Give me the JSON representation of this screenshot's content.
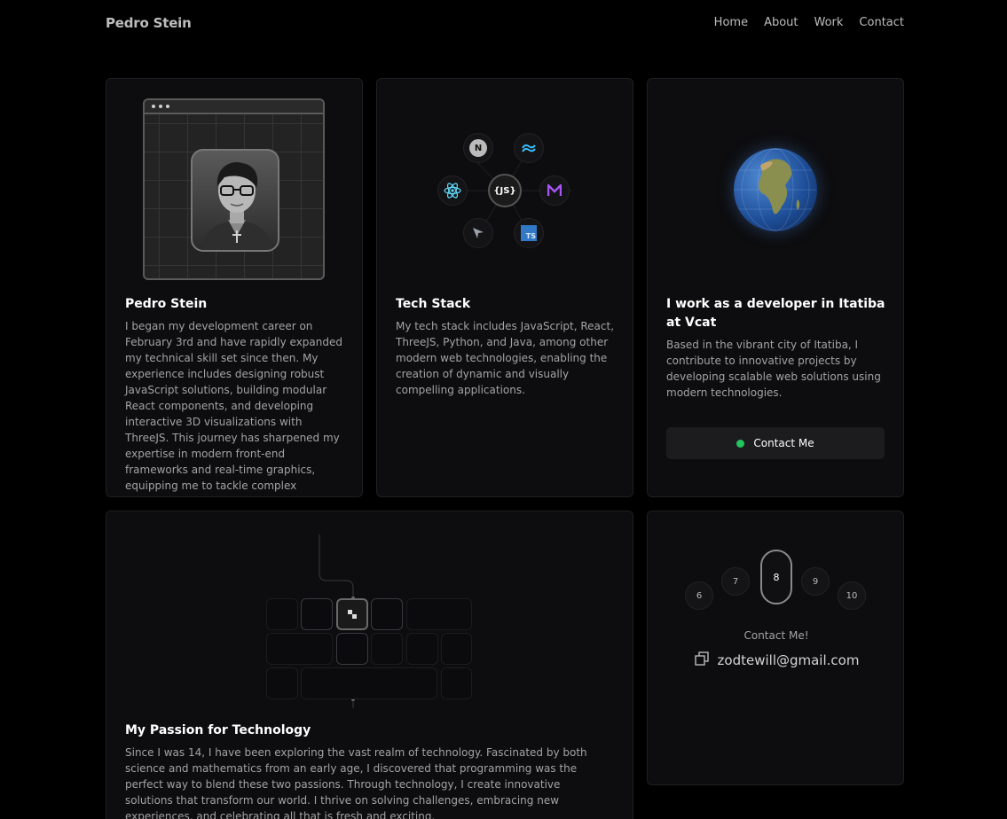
{
  "nav": {
    "brand": "Pedro Stein",
    "links": [
      "Home",
      "About",
      "Work",
      "Contact"
    ]
  },
  "profile": {
    "title": "Pedro Stein",
    "text": "I began my development career on February 3rd and have rapidly expanded my technical skill set since then. My experience includes designing robust JavaScript solutions, building modular React components, and developing interactive 3D visualizations with ThreeJS. This journey has sharpened my expertise in modern front-end frameworks and real-time graphics, equipping me to tackle complex technical challenges."
  },
  "stack": {
    "title": "Tech Stack",
    "text": "My tech stack includes JavaScript, React, ThreeJS, Python, and Java, among other modern web technologies, enabling the creation of dynamic and visually compelling applications.",
    "icons": {
      "next": "N",
      "center": "{JS}",
      "ts": "TS"
    }
  },
  "location": {
    "title": "I work as a developer in Itatiba at Vcat",
    "text": "Based in the vibrant city of Itatiba, I contribute to innovative projects by developing scalable web solutions using modern technologies.",
    "button": "Contact Me",
    "status_color": "#22c55e"
  },
  "passion": {
    "title": "My Passion for Technology",
    "text": "Since I was 14, I have been exploring the vast realm of technology. Fascinated by both science and mathematics from an early age, I discovered that programming was the perfect way to blend these two passions. Through technology, I create innovative solutions that transform our world. I thrive on solving challenges, embracing new experiences, and celebrating all that is fresh and exciting."
  },
  "contact": {
    "numbers": [
      "6",
      "7",
      "8",
      "9",
      "10"
    ],
    "label": "Contact Me!",
    "email": "zodtewill@gmail.com",
    "copy_icon": "copy-icon"
  }
}
